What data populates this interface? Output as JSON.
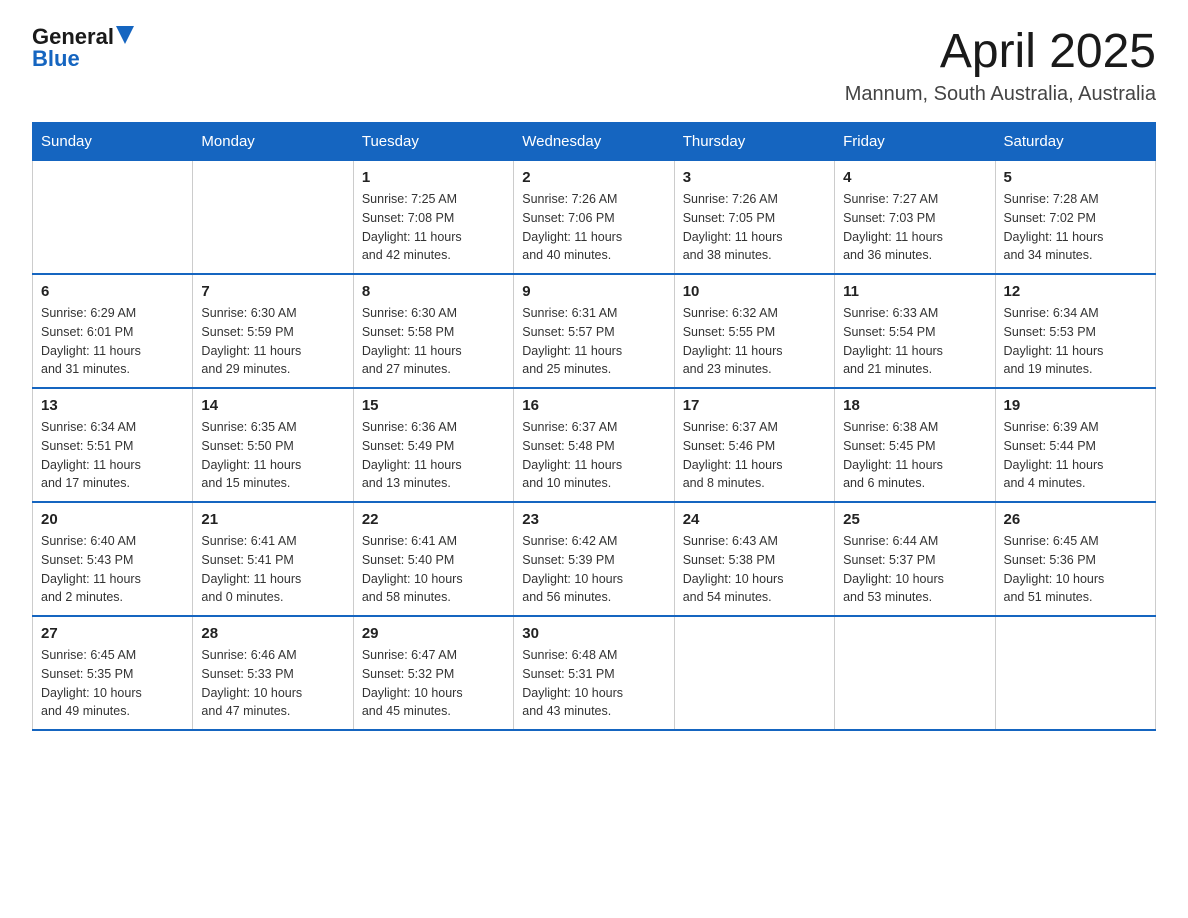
{
  "header": {
    "logo": {
      "general": "General",
      "blue": "Blue"
    },
    "title": "April 2025",
    "subtitle": "Mannum, South Australia, Australia"
  },
  "calendar": {
    "days_of_week": [
      "Sunday",
      "Monday",
      "Tuesday",
      "Wednesday",
      "Thursday",
      "Friday",
      "Saturday"
    ],
    "weeks": [
      [
        {
          "day": "",
          "info": ""
        },
        {
          "day": "",
          "info": ""
        },
        {
          "day": "1",
          "info": "Sunrise: 7:25 AM\nSunset: 7:08 PM\nDaylight: 11 hours\nand 42 minutes."
        },
        {
          "day": "2",
          "info": "Sunrise: 7:26 AM\nSunset: 7:06 PM\nDaylight: 11 hours\nand 40 minutes."
        },
        {
          "day": "3",
          "info": "Sunrise: 7:26 AM\nSunset: 7:05 PM\nDaylight: 11 hours\nand 38 minutes."
        },
        {
          "day": "4",
          "info": "Sunrise: 7:27 AM\nSunset: 7:03 PM\nDaylight: 11 hours\nand 36 minutes."
        },
        {
          "day": "5",
          "info": "Sunrise: 7:28 AM\nSunset: 7:02 PM\nDaylight: 11 hours\nand 34 minutes."
        }
      ],
      [
        {
          "day": "6",
          "info": "Sunrise: 6:29 AM\nSunset: 6:01 PM\nDaylight: 11 hours\nand 31 minutes."
        },
        {
          "day": "7",
          "info": "Sunrise: 6:30 AM\nSunset: 5:59 PM\nDaylight: 11 hours\nand 29 minutes."
        },
        {
          "day": "8",
          "info": "Sunrise: 6:30 AM\nSunset: 5:58 PM\nDaylight: 11 hours\nand 27 minutes."
        },
        {
          "day": "9",
          "info": "Sunrise: 6:31 AM\nSunset: 5:57 PM\nDaylight: 11 hours\nand 25 minutes."
        },
        {
          "day": "10",
          "info": "Sunrise: 6:32 AM\nSunset: 5:55 PM\nDaylight: 11 hours\nand 23 minutes."
        },
        {
          "day": "11",
          "info": "Sunrise: 6:33 AM\nSunset: 5:54 PM\nDaylight: 11 hours\nand 21 minutes."
        },
        {
          "day": "12",
          "info": "Sunrise: 6:34 AM\nSunset: 5:53 PM\nDaylight: 11 hours\nand 19 minutes."
        }
      ],
      [
        {
          "day": "13",
          "info": "Sunrise: 6:34 AM\nSunset: 5:51 PM\nDaylight: 11 hours\nand 17 minutes."
        },
        {
          "day": "14",
          "info": "Sunrise: 6:35 AM\nSunset: 5:50 PM\nDaylight: 11 hours\nand 15 minutes."
        },
        {
          "day": "15",
          "info": "Sunrise: 6:36 AM\nSunset: 5:49 PM\nDaylight: 11 hours\nand 13 minutes."
        },
        {
          "day": "16",
          "info": "Sunrise: 6:37 AM\nSunset: 5:48 PM\nDaylight: 11 hours\nand 10 minutes."
        },
        {
          "day": "17",
          "info": "Sunrise: 6:37 AM\nSunset: 5:46 PM\nDaylight: 11 hours\nand 8 minutes."
        },
        {
          "day": "18",
          "info": "Sunrise: 6:38 AM\nSunset: 5:45 PM\nDaylight: 11 hours\nand 6 minutes."
        },
        {
          "day": "19",
          "info": "Sunrise: 6:39 AM\nSunset: 5:44 PM\nDaylight: 11 hours\nand 4 minutes."
        }
      ],
      [
        {
          "day": "20",
          "info": "Sunrise: 6:40 AM\nSunset: 5:43 PM\nDaylight: 11 hours\nand 2 minutes."
        },
        {
          "day": "21",
          "info": "Sunrise: 6:41 AM\nSunset: 5:41 PM\nDaylight: 11 hours\nand 0 minutes."
        },
        {
          "day": "22",
          "info": "Sunrise: 6:41 AM\nSunset: 5:40 PM\nDaylight: 10 hours\nand 58 minutes."
        },
        {
          "day": "23",
          "info": "Sunrise: 6:42 AM\nSunset: 5:39 PM\nDaylight: 10 hours\nand 56 minutes."
        },
        {
          "day": "24",
          "info": "Sunrise: 6:43 AM\nSunset: 5:38 PM\nDaylight: 10 hours\nand 54 minutes."
        },
        {
          "day": "25",
          "info": "Sunrise: 6:44 AM\nSunset: 5:37 PM\nDaylight: 10 hours\nand 53 minutes."
        },
        {
          "day": "26",
          "info": "Sunrise: 6:45 AM\nSunset: 5:36 PM\nDaylight: 10 hours\nand 51 minutes."
        }
      ],
      [
        {
          "day": "27",
          "info": "Sunrise: 6:45 AM\nSunset: 5:35 PM\nDaylight: 10 hours\nand 49 minutes."
        },
        {
          "day": "28",
          "info": "Sunrise: 6:46 AM\nSunset: 5:33 PM\nDaylight: 10 hours\nand 47 minutes."
        },
        {
          "day": "29",
          "info": "Sunrise: 6:47 AM\nSunset: 5:32 PM\nDaylight: 10 hours\nand 45 minutes."
        },
        {
          "day": "30",
          "info": "Sunrise: 6:48 AM\nSunset: 5:31 PM\nDaylight: 10 hours\nand 43 minutes."
        },
        {
          "day": "",
          "info": ""
        },
        {
          "day": "",
          "info": ""
        },
        {
          "day": "",
          "info": ""
        }
      ]
    ]
  }
}
